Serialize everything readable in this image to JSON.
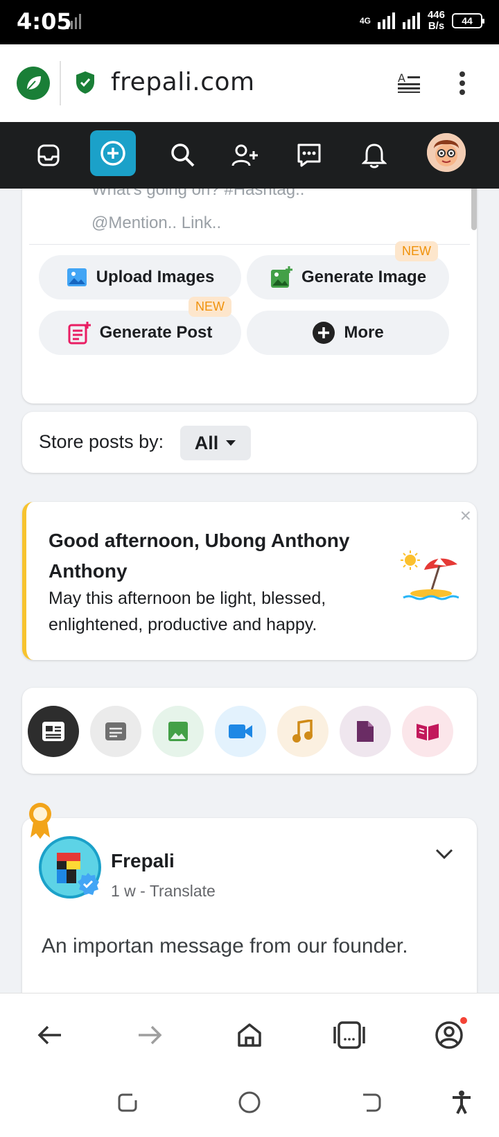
{
  "status_bar": {
    "time": "4:05",
    "net_type": "4G",
    "speed_value": "446",
    "speed_unit": "B/s",
    "battery": "44"
  },
  "browser": {
    "url": "frepali.com"
  },
  "site_nav": {
    "icons": [
      "feed-icon",
      "create-icon",
      "search-icon",
      "add-friend-icon",
      "messages-icon",
      "notifications-icon",
      "profile-avatar"
    ]
  },
  "composer": {
    "placeholder_line1": "What's going on? #Hashtag..",
    "placeholder_line2": "@Mention.. Link..",
    "actions": {
      "upload_images": "Upload Images",
      "generate_image": "Generate Image",
      "generate_post": "Generate Post",
      "more": "More"
    },
    "new_badge": "NEW"
  },
  "store_posts": {
    "label": "Store posts by:",
    "value": "All"
  },
  "greeting": {
    "title": "Good afternoon, Ubong Anthony Anthony",
    "message": "May this afternoon be light, blessed, enlightened, productive and happy.",
    "close": "×"
  },
  "filters": [
    "all-posts",
    "text",
    "photos",
    "videos",
    "audio",
    "files",
    "blogs"
  ],
  "post": {
    "author": "Frepali",
    "time": "1 w",
    "separator": " - ",
    "translate": "Translate",
    "text": "An importan message from our founder."
  },
  "colors": {
    "accent": "#1ba1c9",
    "greeting_border": "#f7c32e",
    "new_badge": "#f0920b"
  }
}
